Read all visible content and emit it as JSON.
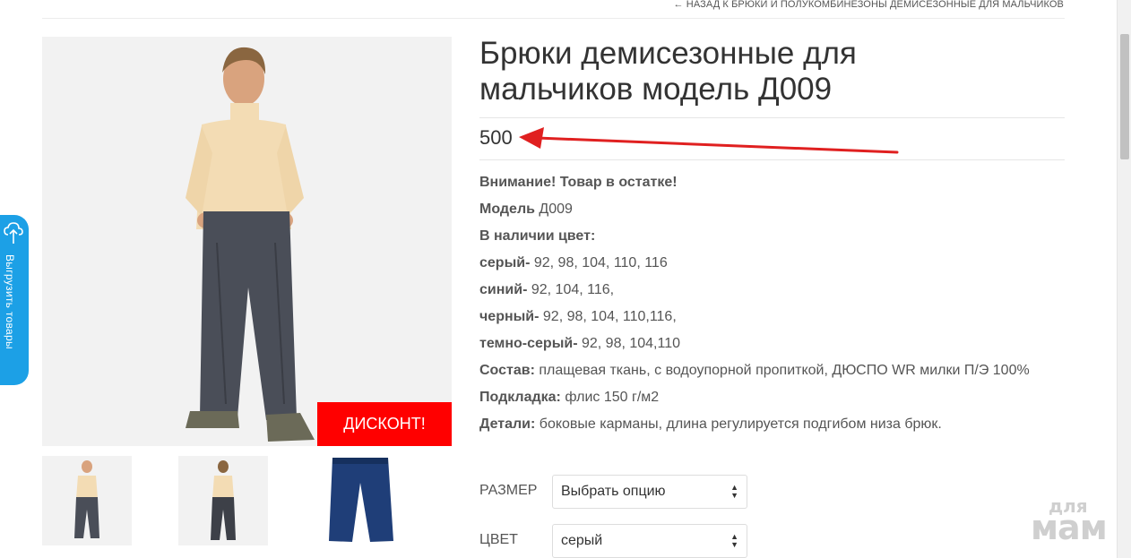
{
  "breadcrumb": "← Назад к Брюки и полукомбинезоны демисезонные для мальчиков",
  "product": {
    "title_line1": "Брюки демисезонные для",
    "title_line2": "мальчиков модель Д009",
    "price": "500",
    "discount_badge": "ДИСКОНТ!"
  },
  "description": [
    {
      "label": "Внимание! Товар в остатке!",
      "text": ""
    },
    {
      "label": "Модель",
      "text": " Д009"
    },
    {
      "label": "В наличии  цвет:",
      "text": ""
    },
    {
      "label": "серый-",
      "text": " 92, 98, 104, 110, 116"
    },
    {
      "label": "синий-",
      "text": " 92, 104, 116,"
    },
    {
      "label": "черный-",
      "text": " 92, 98, 104, 110,116,"
    },
    {
      "label": "темно-серый-",
      "text": " 92, 98, 104,110"
    },
    {
      "label": "Состав:",
      "text": " плащевая ткань, с водоупорной пропиткой, ДЮСПО WR милки  П/Э 100%"
    },
    {
      "label": "Подкладка:",
      "text": " флис 150 г/м2"
    },
    {
      "label": "Детали:",
      "text": " боковые карманы, длина регулируется подгибом низа брюк."
    }
  ],
  "options": {
    "size_label": "РАЗМЕР",
    "size_value": "Выбрать опцию",
    "color_label": "ЦВЕТ",
    "color_value": "серый"
  },
  "side_tab": {
    "label": "Выгрузить товары",
    "icon": "cloud-upload-icon"
  },
  "watermark": {
    "line1": "для",
    "line2": "мам"
  },
  "colors": {
    "discount": "#ff0000",
    "arrow": "#e02020",
    "side_tab": "#1ca0e6"
  }
}
